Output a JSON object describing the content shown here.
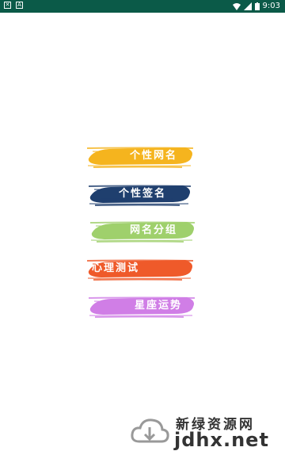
{
  "status_bar": {
    "time": "9:03",
    "icons": [
      "notification-x-icon",
      "notification-app-icon",
      "wifi-icon",
      "signal-icon",
      "battery-icon"
    ],
    "background": "#0b5a48"
  },
  "menu": {
    "items": [
      {
        "label": "个性网名",
        "color": "#f5b41e"
      },
      {
        "label": "个性签名",
        "color": "#1f3f6e"
      },
      {
        "label": "网名分组",
        "color": "#9fd06c"
      },
      {
        "label": "心理测试",
        "color": "#ef5a2a"
      },
      {
        "label": "星座运势",
        "color": "#d07ee6"
      }
    ]
  },
  "watermark": {
    "title": "新绿资源网",
    "url": "jdhx.net"
  }
}
